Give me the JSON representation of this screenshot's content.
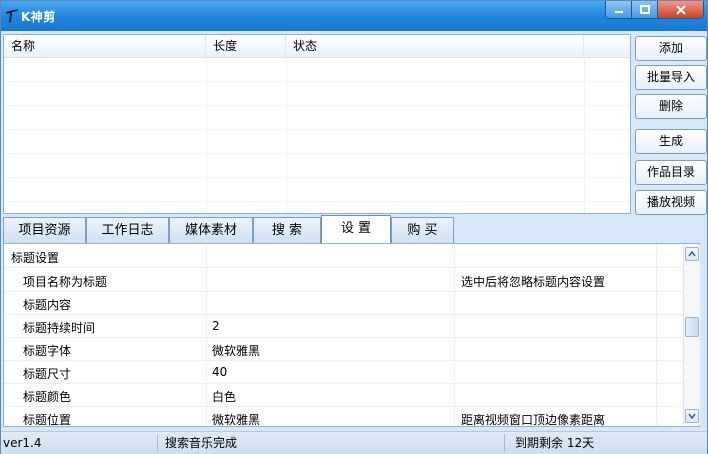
{
  "window": {
    "title": "K神剪",
    "controls": {
      "minimize": "—",
      "maximize": "□",
      "close": "✕"
    }
  },
  "listview": {
    "columns": [
      "名称",
      "长度",
      "状态"
    ],
    "rows": []
  },
  "side_buttons": [
    "添加",
    "批量导入",
    "删除",
    "生成",
    "作品目录",
    "播放视频"
  ],
  "tabs": [
    "项目资源",
    "工作日志",
    "媒体素材",
    "搜 索",
    "设 置",
    "购 买"
  ],
  "active_tab": "设 置",
  "settings": {
    "section": "标题设置",
    "rows": [
      {
        "name": "项目名称为标题",
        "value": "",
        "desc": "选中后将忽略标题内容设置"
      },
      {
        "name": "标题内容",
        "value": "",
        "desc": ""
      },
      {
        "name": "标题持续时间",
        "value": "2",
        "desc": ""
      },
      {
        "name": "标题字体",
        "value": "微软雅黑",
        "desc": ""
      },
      {
        "name": "标题尺寸",
        "value": "40",
        "desc": ""
      },
      {
        "name": "标题颜色",
        "value": "白色",
        "desc": ""
      },
      {
        "name": "标题位置",
        "value": "微软雅黑",
        "desc": "距离视频窗口顶边像素距离"
      }
    ]
  },
  "statusbar": {
    "version": "ver1.4",
    "message": "搜索音乐完成",
    "expiry": "到期剩余 12天"
  },
  "colors": {
    "titlebar": "#1f84dc",
    "accent": "#4aa7ef",
    "close": "#c9412a"
  }
}
